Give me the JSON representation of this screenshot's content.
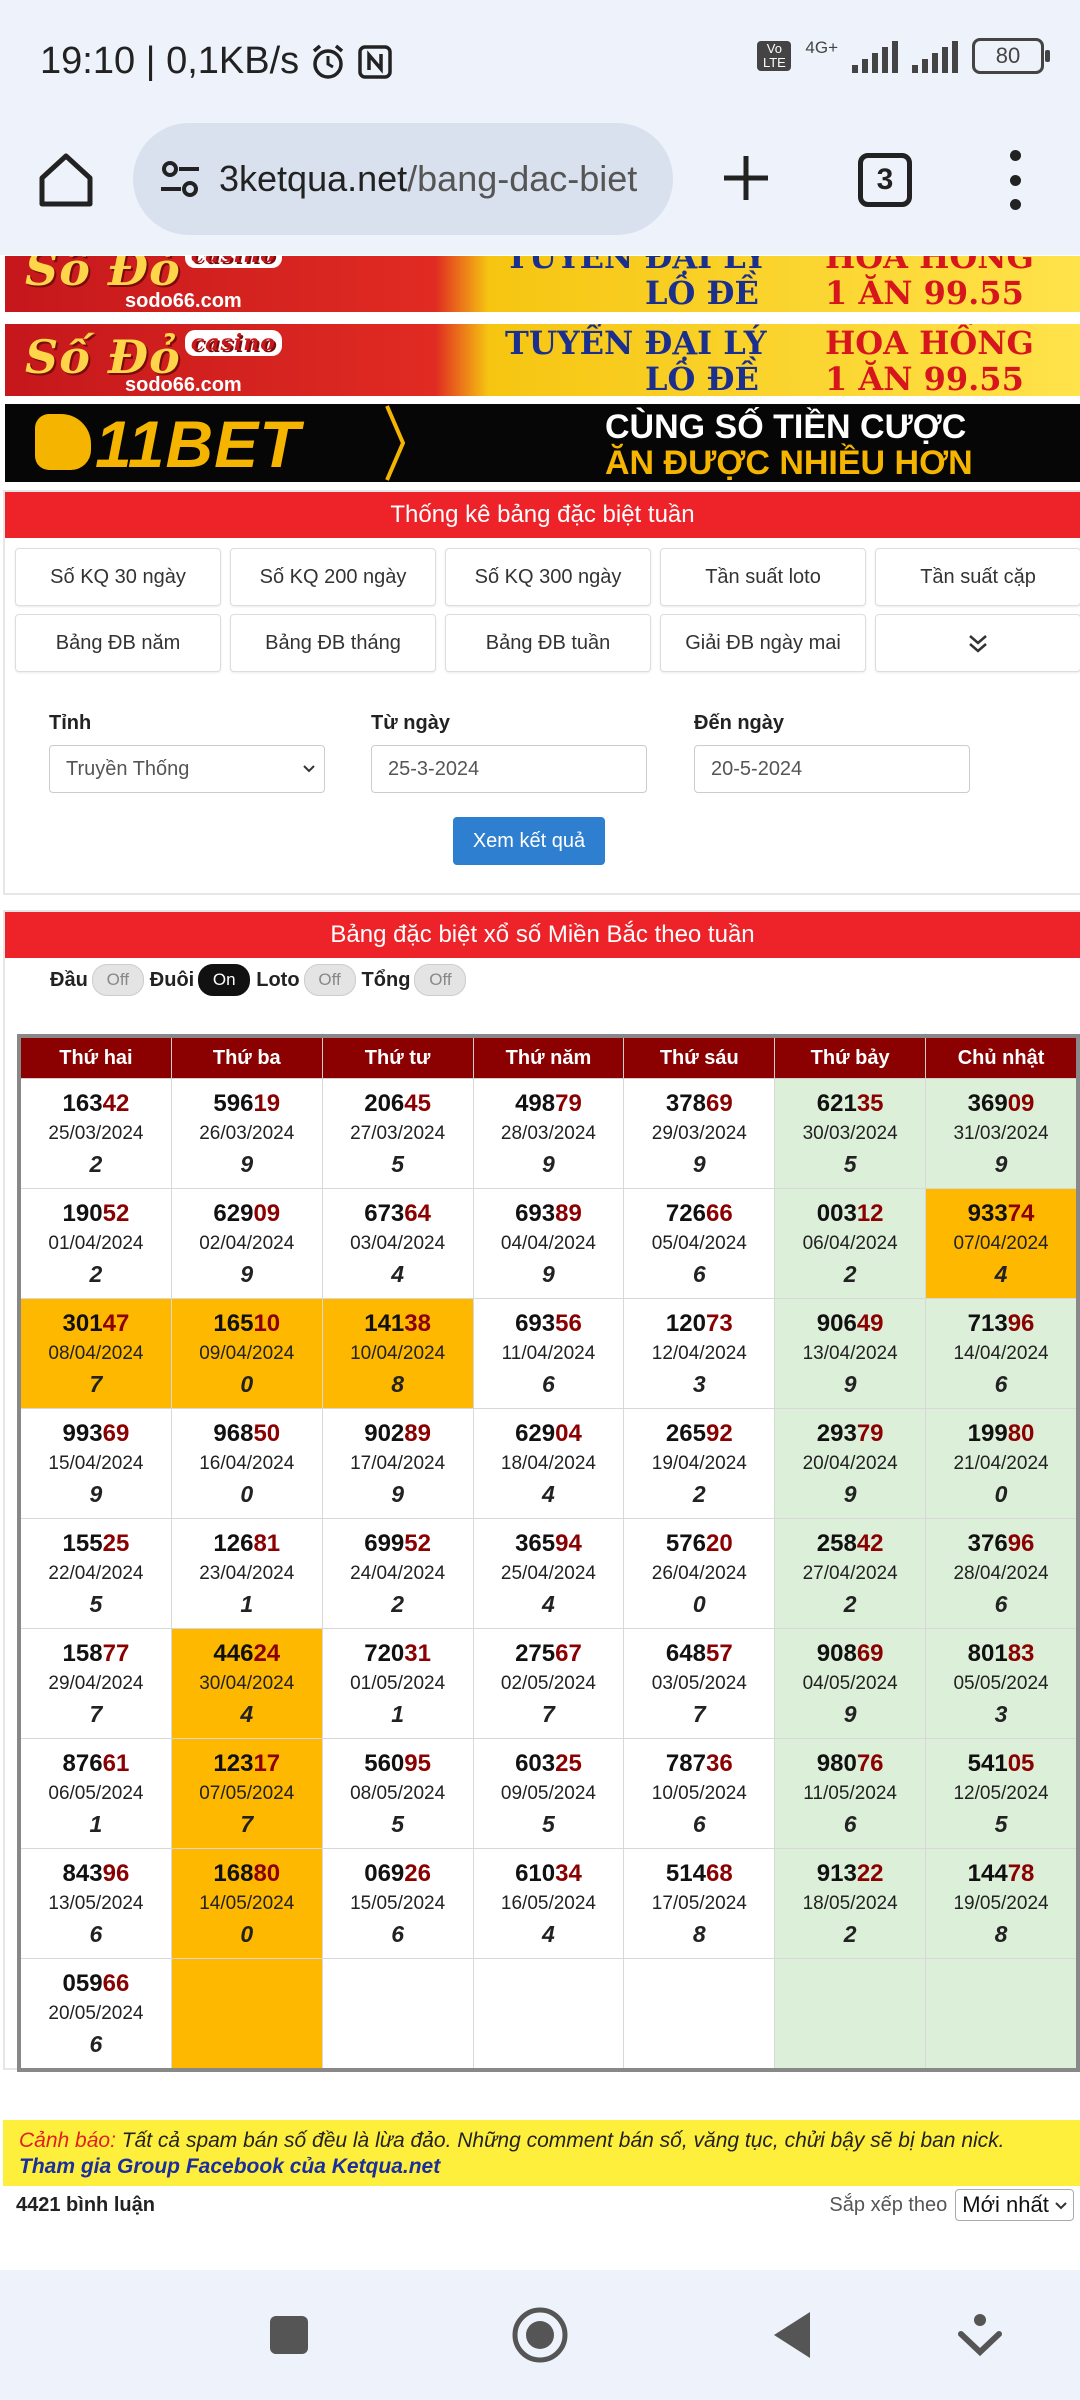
{
  "status_bar": {
    "time_and_speed": "19:10 | 0,1KB/s",
    "network": "4G+",
    "volte": "Vo LTE",
    "battery": "80"
  },
  "browser": {
    "url_domain": "3ketqua.net",
    "url_path": "/bang-dac-biet",
    "tab_count": "3"
  },
  "ads": {
    "sodo": {
      "logo": "Số Đỏ",
      "badge": "casino",
      "site": "sodo66.com",
      "line1a": "TUYỂN ĐẠI LÝ",
      "line1b": "HOA HỒNG",
      "line2a": "LÔ ĐỀ",
      "line2b": "1 ĂN 99.55"
    },
    "bet": {
      "brand": "11BET",
      "line1": "CÙNG SỐ TIỀN CƯỢC",
      "line2": "ĂN ĐƯỢC NHIỀU HƠN"
    }
  },
  "filter_panel": {
    "title": "Thống kê bảng đặc biệt tuần",
    "nav_row1": [
      "Số KQ 30 ngày",
      "Số KQ 200 ngày",
      "Số KQ 300 ngày",
      "Tần suất loto",
      "Tần suất cặp"
    ],
    "nav_row2": [
      "Bảng ĐB năm",
      "Bảng ĐB tháng",
      "Bảng ĐB tuần",
      "Giải ĐB ngày mai"
    ],
    "province_label": "Tỉnh",
    "province_value": "Truyền Thống",
    "from_label": "Từ ngày",
    "from_value": "25-3-2024",
    "to_label": "Đến ngày",
    "to_value": "20-5-2024",
    "submit": "Xem kết quả"
  },
  "weekly": {
    "title": "Bảng đặc biệt xổ số Miền Bắc theo tuần",
    "toggles": {
      "dau_label": "Đầu",
      "dau_state": "Off",
      "duoi_label": "Đuôi",
      "duoi_state": "On",
      "loto_label": "Loto",
      "loto_state": "Off",
      "tong_label": "Tổng",
      "tong_state": "Off"
    },
    "headers": [
      "Thứ hai",
      "Thứ ba",
      "Thứ tư",
      "Thứ năm",
      "Thứ sáu",
      "Thứ bảy",
      "Chủ nhật"
    ],
    "rows": [
      [
        {
          "h": "163",
          "t": "42",
          "d": "25/03/2024",
          "s": "2"
        },
        {
          "h": "596",
          "t": "19",
          "d": "26/03/2024",
          "s": "9"
        },
        {
          "h": "206",
          "t": "45",
          "d": "27/03/2024",
          "s": "5"
        },
        {
          "h": "498",
          "t": "79",
          "d": "28/03/2024",
          "s": "9"
        },
        {
          "h": "378",
          "t": "69",
          "d": "29/03/2024",
          "s": "9"
        },
        {
          "h": "621",
          "t": "35",
          "d": "30/03/2024",
          "s": "5"
        },
        {
          "h": "369",
          "t": "09",
          "d": "31/03/2024",
          "s": "9"
        }
      ],
      [
        {
          "h": "190",
          "t": "52",
          "d": "01/04/2024",
          "s": "2"
        },
        {
          "h": "629",
          "t": "09",
          "d": "02/04/2024",
          "s": "9"
        },
        {
          "h": "673",
          "t": "64",
          "d": "03/04/2024",
          "s": "4"
        },
        {
          "h": "693",
          "t": "89",
          "d": "04/04/2024",
          "s": "9"
        },
        {
          "h": "726",
          "t": "66",
          "d": "05/04/2024",
          "s": "6"
        },
        {
          "h": "003",
          "t": "12",
          "d": "06/04/2024",
          "s": "2"
        },
        {
          "h": "933",
          "t": "74",
          "d": "07/04/2024",
          "s": "4",
          "hl": true
        }
      ],
      [
        {
          "h": "301",
          "t": "47",
          "d": "08/04/2024",
          "s": "7",
          "hl": true
        },
        {
          "h": "165",
          "t": "10",
          "d": "09/04/2024",
          "s": "0",
          "hl": true
        },
        {
          "h": "141",
          "t": "38",
          "d": "10/04/2024",
          "s": "8",
          "hl": true
        },
        {
          "h": "693",
          "t": "56",
          "d": "11/04/2024",
          "s": "6"
        },
        {
          "h": "120",
          "t": "73",
          "d": "12/04/2024",
          "s": "3"
        },
        {
          "h": "906",
          "t": "49",
          "d": "13/04/2024",
          "s": "9"
        },
        {
          "h": "713",
          "t": "96",
          "d": "14/04/2024",
          "s": "6"
        }
      ],
      [
        {
          "h": "993",
          "t": "69",
          "d": "15/04/2024",
          "s": "9"
        },
        {
          "h": "968",
          "t": "50",
          "d": "16/04/2024",
          "s": "0"
        },
        {
          "h": "902",
          "t": "89",
          "d": "17/04/2024",
          "s": "9"
        },
        {
          "h": "629",
          "t": "04",
          "d": "18/04/2024",
          "s": "4"
        },
        {
          "h": "265",
          "t": "92",
          "d": "19/04/2024",
          "s": "2"
        },
        {
          "h": "293",
          "t": "79",
          "d": "20/04/2024",
          "s": "9"
        },
        {
          "h": "199",
          "t": "80",
          "d": "21/04/2024",
          "s": "0"
        }
      ],
      [
        {
          "h": "155",
          "t": "25",
          "d": "22/04/2024",
          "s": "5"
        },
        {
          "h": "126",
          "t": "81",
          "d": "23/04/2024",
          "s": "1"
        },
        {
          "h": "699",
          "t": "52",
          "d": "24/04/2024",
          "s": "2"
        },
        {
          "h": "365",
          "t": "94",
          "d": "25/04/2024",
          "s": "4"
        },
        {
          "h": "576",
          "t": "20",
          "d": "26/04/2024",
          "s": "0"
        },
        {
          "h": "258",
          "t": "42",
          "d": "27/04/2024",
          "s": "2"
        },
        {
          "h": "376",
          "t": "96",
          "d": "28/04/2024",
          "s": "6"
        }
      ],
      [
        {
          "h": "158",
          "t": "77",
          "d": "29/04/2024",
          "s": "7"
        },
        {
          "h": "446",
          "t": "24",
          "d": "30/04/2024",
          "s": "4",
          "hl": true
        },
        {
          "h": "720",
          "t": "31",
          "d": "01/05/2024",
          "s": "1"
        },
        {
          "h": "275",
          "t": "67",
          "d": "02/05/2024",
          "s": "7"
        },
        {
          "h": "648",
          "t": "57",
          "d": "03/05/2024",
          "s": "7"
        },
        {
          "h": "908",
          "t": "69",
          "d": "04/05/2024",
          "s": "9"
        },
        {
          "h": "801",
          "t": "83",
          "d": "05/05/2024",
          "s": "3"
        }
      ],
      [
        {
          "h": "876",
          "t": "61",
          "d": "06/05/2024",
          "s": "1"
        },
        {
          "h": "123",
          "t": "17",
          "d": "07/05/2024",
          "s": "7",
          "hl": true
        },
        {
          "h": "560",
          "t": "95",
          "d": "08/05/2024",
          "s": "5"
        },
        {
          "h": "603",
          "t": "25",
          "d": "09/05/2024",
          "s": "5"
        },
        {
          "h": "787",
          "t": "36",
          "d": "10/05/2024",
          "s": "6"
        },
        {
          "h": "980",
          "t": "76",
          "d": "11/05/2024",
          "s": "6"
        },
        {
          "h": "541",
          "t": "05",
          "d": "12/05/2024",
          "s": "5"
        }
      ],
      [
        {
          "h": "843",
          "t": "96",
          "d": "13/05/2024",
          "s": "6"
        },
        {
          "h": "168",
          "t": "80",
          "d": "14/05/2024",
          "s": "0",
          "hl": true
        },
        {
          "h": "069",
          "t": "26",
          "d": "15/05/2024",
          "s": "6"
        },
        {
          "h": "610",
          "t": "34",
          "d": "16/05/2024",
          "s": "4"
        },
        {
          "h": "514",
          "t": "68",
          "d": "17/05/2024",
          "s": "8"
        },
        {
          "h": "913",
          "t": "22",
          "d": "18/05/2024",
          "s": "2"
        },
        {
          "h": "144",
          "t": "78",
          "d": "19/05/2024",
          "s": "8"
        }
      ],
      [
        {
          "h": "059",
          "t": "66",
          "d": "20/05/2024",
          "s": "6"
        },
        {
          "hl": true
        },
        {},
        {},
        {},
        {},
        {}
      ]
    ]
  },
  "warning": {
    "lead": "Cảnh báo:",
    "text": " Tất cả spam bán số đều là lừa đảo. Những comment bán số, văng tục, chửi bậy sẽ bị ban nick.",
    "link": "Tham gia Group Facebook của Ketqua.net"
  },
  "comments": {
    "count": "4421 bình luận",
    "sort_label": "Sắp xếp theo",
    "sort_value": "Mới nhất"
  }
}
